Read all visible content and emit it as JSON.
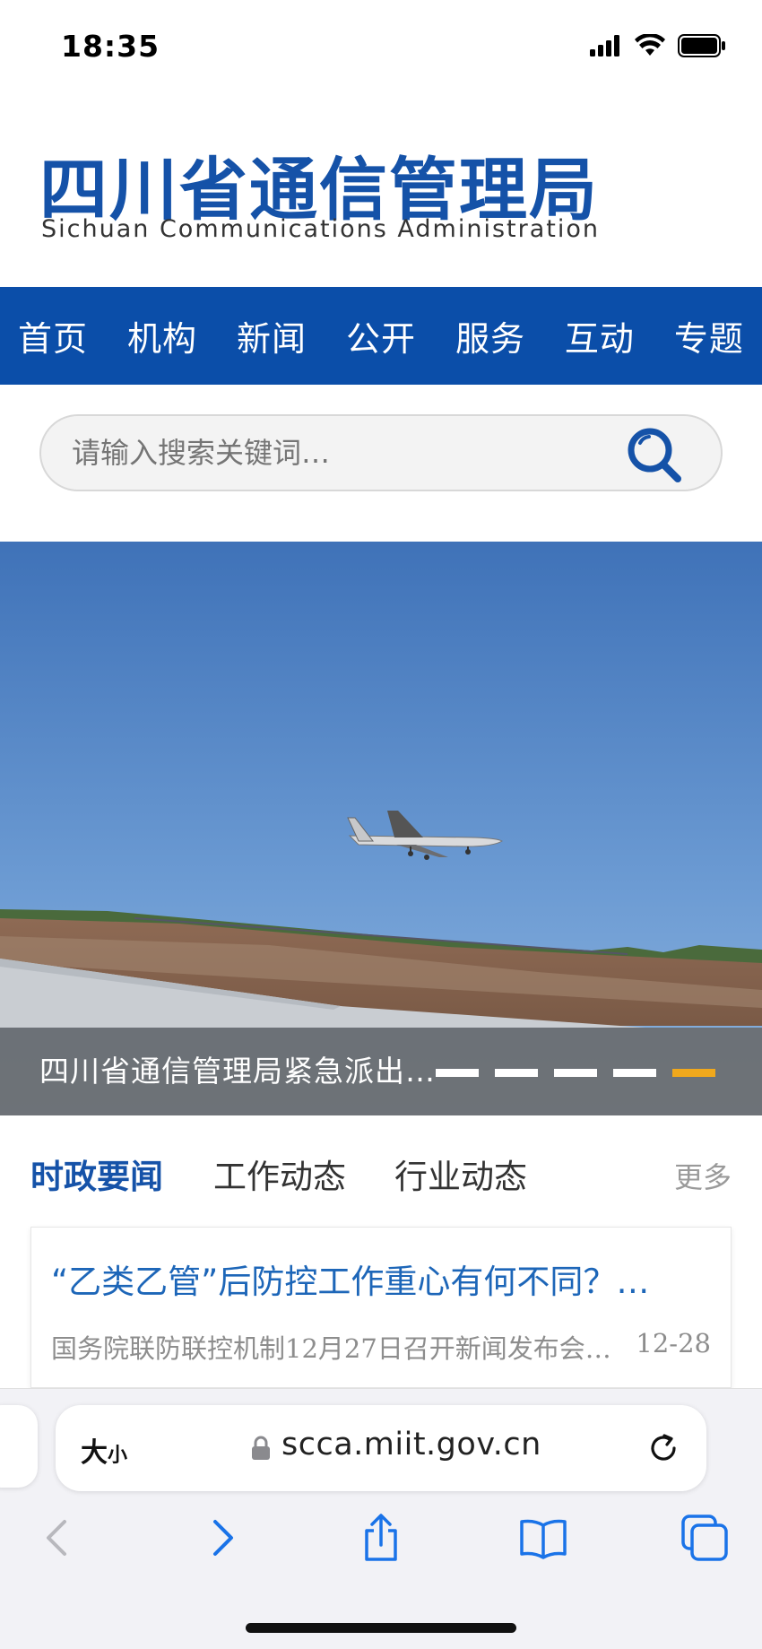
{
  "status": {
    "time": "18:35"
  },
  "header": {
    "title_cn": "四川省通信管理局",
    "title_en": "Sichuan Communications Administration"
  },
  "nav": [
    "首页",
    "机构",
    "新闻",
    "公开",
    "服务",
    "互动",
    "专题"
  ],
  "search": {
    "placeholder": "请输入搜索关键词…"
  },
  "banner": {
    "caption": "四川省通信管理局紧急派出…",
    "slide_count": 5,
    "active_slide": 5
  },
  "news_tabs": {
    "items": [
      "时政要闻",
      "工作动态",
      "行业动态"
    ],
    "active": 0,
    "more": "更多"
  },
  "news": [
    {
      "title": "“乙类乙管”后防控工作重心有何不同？…",
      "desc": "国务院联防联控机制12月27日召开新闻发布会…",
      "date": "12-28"
    }
  ],
  "browser": {
    "text_size_label": "大",
    "text_size_small": "小",
    "url": "scca.miit.gov.cn"
  },
  "colors": {
    "brand": "#0b4ea9",
    "accent": "#f0a81c",
    "link": "#1d66b8"
  }
}
